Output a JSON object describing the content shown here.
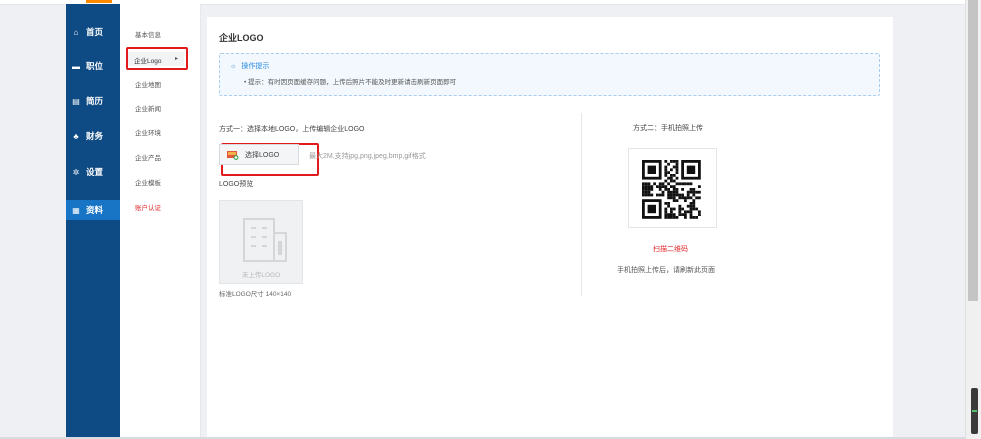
{
  "sidebar": {
    "items": [
      {
        "icon": "home-icon",
        "glyph": "⌂",
        "label": "首页"
      },
      {
        "icon": "briefcase-icon",
        "glyph": "▬",
        "label": "职位"
      },
      {
        "icon": "resume-icon",
        "glyph": "▤",
        "label": "简历"
      },
      {
        "icon": "finance-icon",
        "glyph": "♣",
        "label": "财务"
      },
      {
        "icon": "gear-icon",
        "glyph": "✲",
        "label": "设置"
      },
      {
        "icon": "data-icon",
        "glyph": "▦",
        "label": "资料"
      }
    ]
  },
  "subnav": {
    "items": [
      {
        "label": "基本信息"
      },
      {
        "label": "企业Logo",
        "arrow": "▸"
      },
      {
        "label": "企业地图"
      },
      {
        "label": "企业新闻"
      },
      {
        "label": "企业环境"
      },
      {
        "label": "企业产品"
      },
      {
        "label": "企业模板"
      },
      {
        "label": "账户认证"
      }
    ]
  },
  "main": {
    "title": "企业LOGO",
    "tip": {
      "title": "操作提示",
      "text": "• 提示：有时因页面缓存问题，上传后照片不能及时更新请击刷新页面即可"
    },
    "method1_label": "方式一：选择本地LOGO，上传编辑企业LOGO",
    "select_button": "选择LOGO",
    "format_hint": "最大2M,支持jpg,png,jpeg,bmp,gif格式",
    "preview_label": "LOGO预览",
    "preview_placeholder": "未上传LOGO",
    "size_note": "标准LOGO尺寸 140×140",
    "method2_label": "方式二：手机拍照上传",
    "scan_label": "扫描二维码",
    "refresh_note": "手机拍照上传后，请刷新此页面"
  },
  "colors": {
    "sidebar": "#0e4a83",
    "sidebar_active": "#1875c6",
    "highlight": "#e11b1b",
    "tip_blue": "#2a8ae0"
  }
}
